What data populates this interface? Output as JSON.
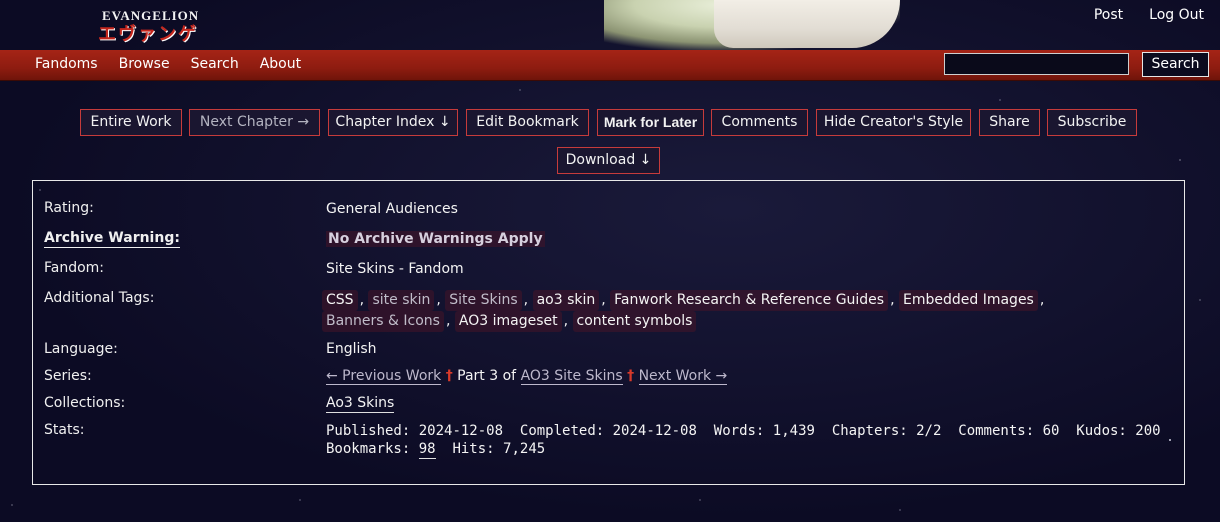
{
  "header": {
    "logo_line1": "EVANGELION",
    "logo_line2": "エヴァンゲリオン",
    "user_links": [
      "Post",
      "Log Out"
    ]
  },
  "nav": {
    "items": [
      "Fandoms",
      "Browse",
      "Search",
      "About"
    ],
    "search_value": "",
    "search_button": "Search"
  },
  "actions": {
    "buttons": [
      "Entire Work",
      "Next Chapter →",
      "Chapter Index ↓",
      "Edit Bookmark",
      "Mark for Later",
      "Comments",
      "Hide Creator's Style",
      "Share",
      "Subscribe",
      "Download ↓"
    ]
  },
  "meta": {
    "labels": {
      "rating": "Rating:",
      "warning": "Archive Warning:",
      "fandom": "Fandom:",
      "tags": "Additional Tags:",
      "language": "Language:",
      "series": "Series:",
      "collections": "Collections:",
      "stats": "Stats:"
    },
    "rating": "General Audiences",
    "warning": "No Archive Warnings Apply",
    "fandom": "Site Skins - Fandom",
    "tags": [
      "CSS",
      "site skin",
      "Site Skins",
      "ao3 skin",
      "Fanwork Research & Reference Guides",
      "Embedded Images",
      "Banners & Icons",
      "AO3 imageset",
      "content symbols"
    ],
    "language": "English",
    "series": {
      "prev": "← Previous Work",
      "part_text": "Part 3 of",
      "series_name": "AO3 Site Skins",
      "next": "Next Work →"
    },
    "collections": "Ao3 Skins",
    "stats": {
      "published_label": "Published:",
      "published": "2024-12-08",
      "completed_label": "Completed:",
      "completed": "2024-12-08",
      "words_label": "Words:",
      "words": "1,439",
      "chapters_label": "Chapters:",
      "chapters": "2/2",
      "comments_label": "Comments:",
      "comments": "60",
      "kudos_label": "Kudos:",
      "kudos": "200",
      "bookmarks_label": "Bookmarks:",
      "bookmarks": "98",
      "hits_label": "Hits:",
      "hits": "7,245"
    }
  }
}
